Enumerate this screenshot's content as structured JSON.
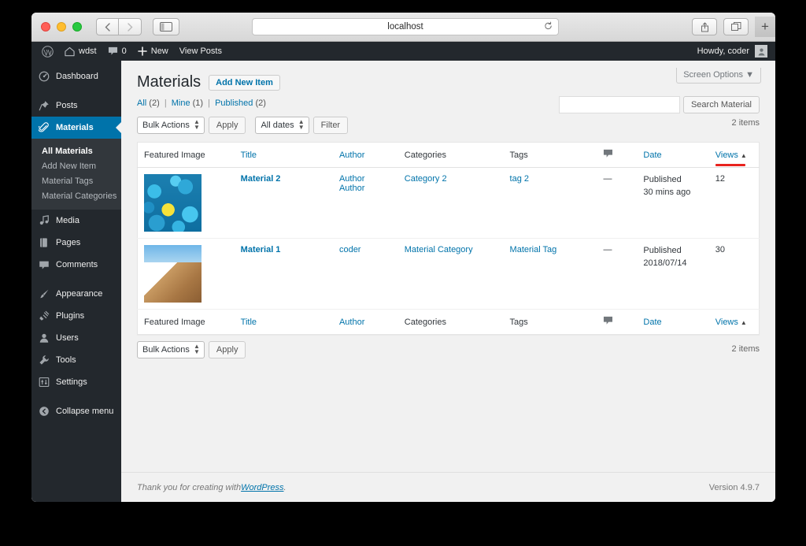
{
  "browser": {
    "address": "localhost",
    "reload_icon": "reload-icon",
    "back_icon": "chevron-left-icon",
    "forward_icon": "chevron-right-icon",
    "sidebar_toggle_icon": "sidebar-toggle-icon",
    "share_icon": "share-icon",
    "tabs_icon": "show-tabs-icon",
    "new_tab_label": "+"
  },
  "adminbar": {
    "logo_icon": "wordpress-logo-icon",
    "site_icon": "home-icon",
    "site_name": "wdst",
    "comments_icon": "comment-bubble-icon",
    "comments_count": "0",
    "new_icon": "plus-icon",
    "new_label": "New",
    "view_posts_label": "View Posts",
    "howdy": "Howdy, coder",
    "avatar_icon": "avatar-icon"
  },
  "sidebar": {
    "items": [
      {
        "label": "Dashboard",
        "icon": "dashboard-icon",
        "active": false
      },
      {
        "label": "Posts",
        "icon": "pin-icon",
        "active": false
      },
      {
        "label": "Materials",
        "icon": "paperclip-icon",
        "active": true
      },
      {
        "label": "Media",
        "icon": "media-icon",
        "active": false
      },
      {
        "label": "Pages",
        "icon": "pages-icon",
        "active": false
      },
      {
        "label": "Comments",
        "icon": "comment-bubble-icon",
        "active": false
      },
      {
        "label": "Appearance",
        "icon": "brush-icon",
        "active": false
      },
      {
        "label": "Plugins",
        "icon": "plug-icon",
        "active": false
      },
      {
        "label": "Users",
        "icon": "user-icon",
        "active": false
      },
      {
        "label": "Tools",
        "icon": "wrench-icon",
        "active": false
      },
      {
        "label": "Settings",
        "icon": "settings-sliders-icon",
        "active": false
      },
      {
        "label": "Collapse menu",
        "icon": "collapse-arrow-icon",
        "active": false
      }
    ],
    "submenu": [
      {
        "label": "All Materials",
        "current": true
      },
      {
        "label": "Add New Item",
        "current": false
      },
      {
        "label": "Material Tags",
        "current": false
      },
      {
        "label": "Material Categories",
        "current": false
      }
    ]
  },
  "main": {
    "screen_options_label": "Screen Options",
    "screen_options_arrow": "▼",
    "page_title": "Materials",
    "add_new_label": "Add New Item",
    "views_filter": {
      "all_label": "All",
      "all_count": "(2)",
      "mine_label": "Mine",
      "mine_count": "(1)",
      "published_label": "Published",
      "published_count": "(2)",
      "separator": "|"
    },
    "toolbar": {
      "bulk_actions_label": "Bulk Actions",
      "apply_label": "Apply",
      "all_dates_label": "All dates",
      "filter_label": "Filter"
    },
    "search": {
      "value": "",
      "placeholder": "",
      "submit_label": "Search Material"
    },
    "displaying_num": "2 items",
    "displaying_num_bottom": "2 items",
    "table": {
      "columns": [
        {
          "label": "Featured Image",
          "sortable": false
        },
        {
          "label": "Title",
          "sortable": true
        },
        {
          "label": "Author",
          "sortable": true
        },
        {
          "label": "Categories",
          "sortable": false
        },
        {
          "label": "Tags",
          "sortable": false
        },
        {
          "label": "",
          "sortable": false,
          "icon": "comment-bubble-icon"
        },
        {
          "label": "Date",
          "sortable": true
        },
        {
          "label": "Views",
          "sortable": true,
          "sort_arrow": "▲",
          "highlighted": true
        }
      ],
      "rows": [
        {
          "thumbnail": "blue-smiley-faces-thumbnail",
          "title": "Material 2",
          "author": "Author Author",
          "categories": "Category 2",
          "tags": "tag 2",
          "comments": "—",
          "date_status": "Published",
          "date_value": "30 mins ago",
          "views": "12"
        },
        {
          "thumbnail": "sand-dune-thumbnail",
          "title": "Material 1",
          "author": "coder",
          "categories": "Material Category",
          "tags": "Material Tag",
          "comments": "—",
          "date_status": "Published",
          "date_value": "2018/07/14",
          "views": "30"
        }
      ]
    },
    "bottom_toolbar": {
      "bulk_actions_label": "Bulk Actions",
      "apply_label": "Apply"
    }
  },
  "footer": {
    "thanks_prefix": "Thank you for creating with ",
    "wordpress_link": "WordPress",
    "thanks_suffix": ".",
    "version": "Version 4.9.7"
  },
  "colors": {
    "wp_blue": "#0073aa",
    "admin_dark": "#23282d",
    "submenu_dark": "#32373c",
    "annotation_red": "#e8231e"
  }
}
